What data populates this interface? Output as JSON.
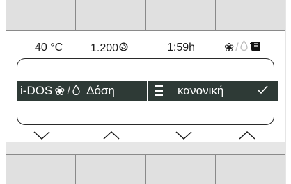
{
  "status": {
    "temperature": "40 °C",
    "spin_speed": "1.200",
    "spin_icon": "spin-icon",
    "time": "1:59h",
    "icons": [
      "fan-icon",
      "drop-icon",
      "detergent-tank-icon"
    ]
  },
  "selector": {
    "left_label": "i-DOS",
    "left_suffix": "Δόση",
    "left_icons": [
      "fan-icon",
      "drop-icon"
    ],
    "right_value": "κανονική",
    "right_icon": "dosage-level-icon",
    "confirm_icon": "check-icon"
  },
  "controls": {
    "arrows": [
      "chevron-down-icon",
      "chevron-up-icon",
      "chevron-down-icon",
      "chevron-up-icon"
    ]
  },
  "colors": {
    "selection_bar": "#2e3a36",
    "softkey_bg": "#e0e0e0",
    "panel_bg": "#e6e6e6"
  }
}
